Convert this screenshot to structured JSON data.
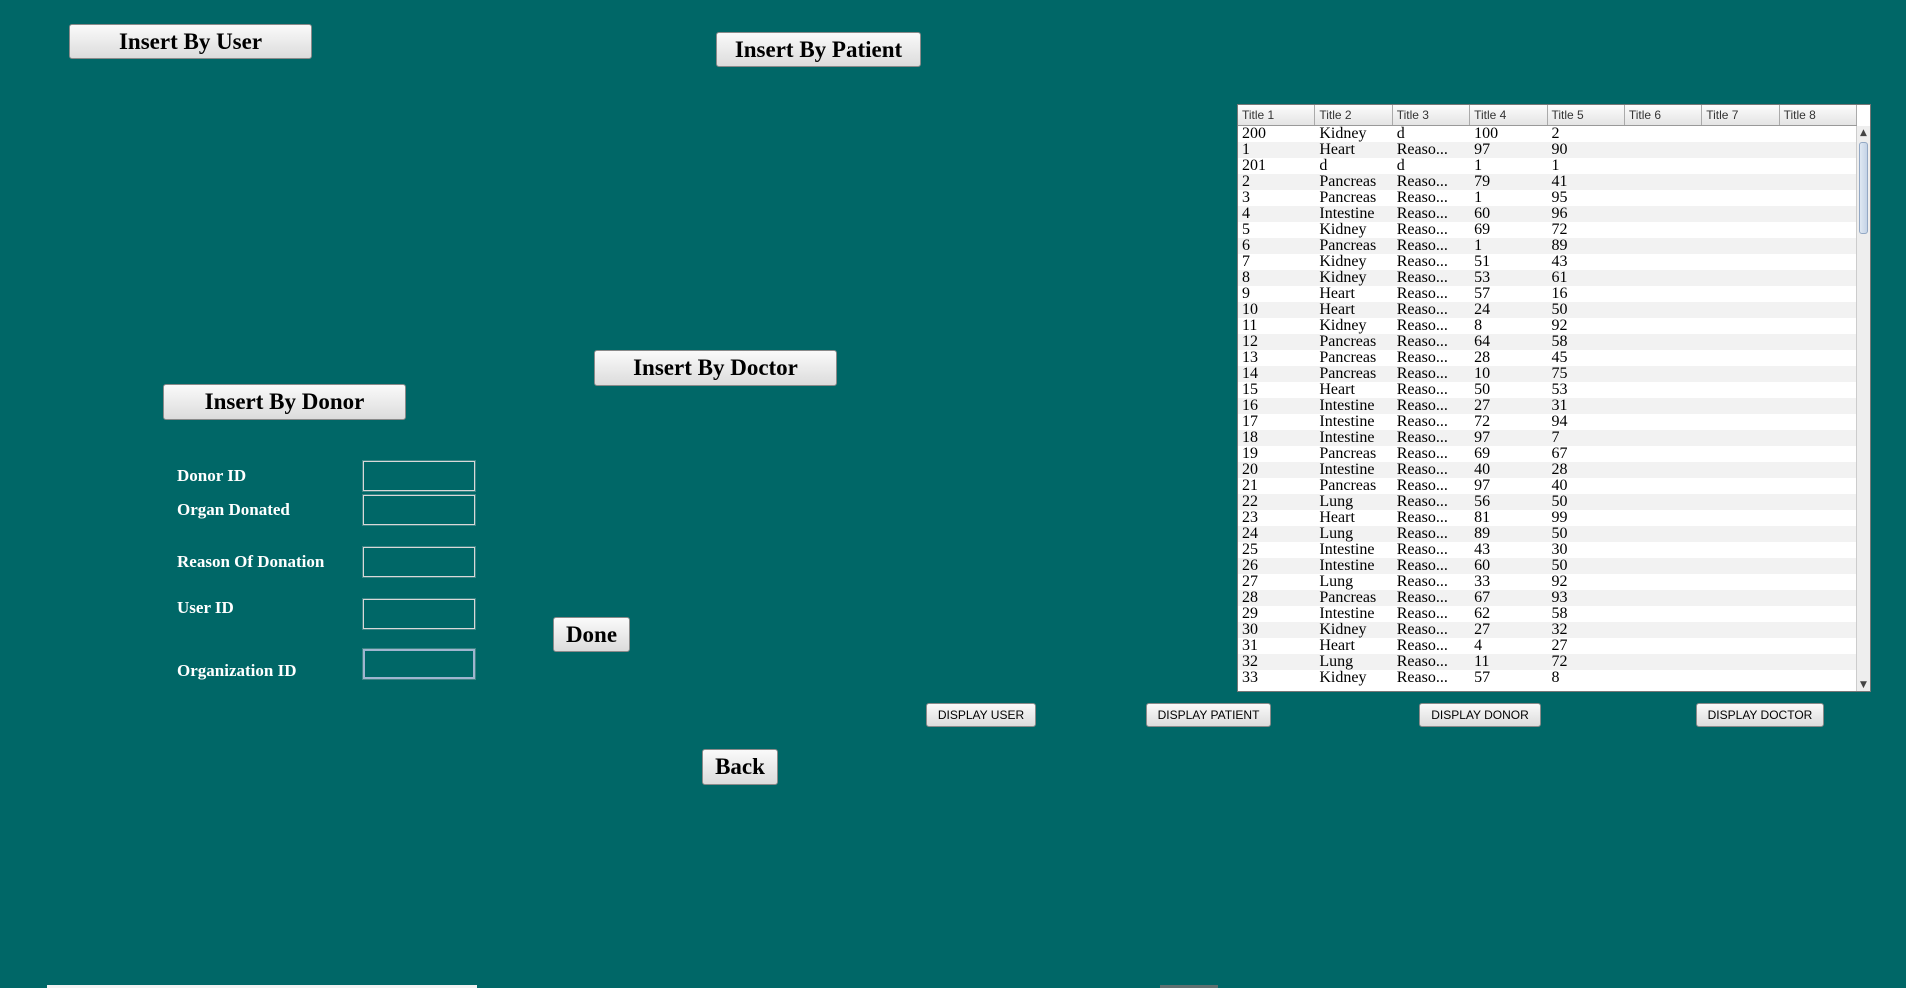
{
  "buttons": {
    "insert_user": "Insert By User",
    "insert_patient": "Insert By Patient",
    "insert_doctor": "Insert By Doctor",
    "insert_donor": "Insert By Donor",
    "done": "Done",
    "back": "Back",
    "display_user": "DISPLAY USER",
    "display_patient": "DISPLAY PATIENT",
    "display_donor": "DISPLAY DONOR",
    "display_doctor": "DISPLAY DOCTOR"
  },
  "form": {
    "donor_id_label": "Donor ID",
    "organ_label": "Organ Donated",
    "reason_label": "Reason Of Donation",
    "user_id_label": "User ID",
    "org_id_label": "Organization ID",
    "donor_id_value": "",
    "organ_value": "",
    "reason_value": "",
    "user_id_value": "",
    "org_id_value": ""
  },
  "table": {
    "columns": [
      "Title 1",
      "Title 2",
      "Title 3",
      "Title 4",
      "Title 5",
      "Title 6",
      "Title 7",
      "Title 8"
    ],
    "rows": [
      [
        "200",
        "Kidney",
        "d",
        "100",
        "2",
        "",
        "",
        ""
      ],
      [
        "1",
        "Heart",
        "Reaso...",
        "97",
        "90",
        "",
        "",
        ""
      ],
      [
        "201",
        "d",
        "d",
        "1",
        "1",
        "",
        "",
        ""
      ],
      [
        "2",
        "Pancreas",
        "Reaso...",
        "79",
        "41",
        "",
        "",
        ""
      ],
      [
        "3",
        "Pancreas",
        "Reaso...",
        "1",
        "95",
        "",
        "",
        ""
      ],
      [
        "4",
        "Intestine",
        "Reaso...",
        "60",
        "96",
        "",
        "",
        ""
      ],
      [
        "5",
        "Kidney",
        "Reaso...",
        "69",
        "72",
        "",
        "",
        ""
      ],
      [
        "6",
        "Pancreas",
        "Reaso...",
        "1",
        "89",
        "",
        "",
        ""
      ],
      [
        "7",
        "Kidney",
        "Reaso...",
        "51",
        "43",
        "",
        "",
        ""
      ],
      [
        "8",
        "Kidney",
        "Reaso...",
        "53",
        "61",
        "",
        "",
        ""
      ],
      [
        "9",
        "Heart",
        "Reaso...",
        "57",
        "16",
        "",
        "",
        ""
      ],
      [
        "10",
        "Heart",
        "Reaso...",
        "24",
        "50",
        "",
        "",
        ""
      ],
      [
        "11",
        "Kidney",
        "Reaso...",
        "8",
        "92",
        "",
        "",
        ""
      ],
      [
        "12",
        "Pancreas",
        "Reaso...",
        "64",
        "58",
        "",
        "",
        ""
      ],
      [
        "13",
        "Pancreas",
        "Reaso...",
        "28",
        "45",
        "",
        "",
        ""
      ],
      [
        "14",
        "Pancreas",
        "Reaso...",
        "10",
        "75",
        "",
        "",
        ""
      ],
      [
        "15",
        "Heart",
        "Reaso...",
        "50",
        "53",
        "",
        "",
        ""
      ],
      [
        "16",
        "Intestine",
        "Reaso...",
        "27",
        "31",
        "",
        "",
        ""
      ],
      [
        "17",
        "Intestine",
        "Reaso...",
        "72",
        "94",
        "",
        "",
        ""
      ],
      [
        "18",
        "Intestine",
        "Reaso...",
        "97",
        "7",
        "",
        "",
        ""
      ],
      [
        "19",
        "Pancreas",
        "Reaso...",
        "69",
        "67",
        "",
        "",
        ""
      ],
      [
        "20",
        "Intestine",
        "Reaso...",
        "40",
        "28",
        "",
        "",
        ""
      ],
      [
        "21",
        "Pancreas",
        "Reaso...",
        "97",
        "40",
        "",
        "",
        ""
      ],
      [
        "22",
        "Lung",
        "Reaso...",
        "56",
        "50",
        "",
        "",
        ""
      ],
      [
        "23",
        "Heart",
        "Reaso...",
        "81",
        "99",
        "",
        "",
        ""
      ],
      [
        "24",
        "Lung",
        "Reaso...",
        "89",
        "50",
        "",
        "",
        ""
      ],
      [
        "25",
        "Intestine",
        "Reaso...",
        "43",
        "30",
        "",
        "",
        ""
      ],
      [
        "26",
        "Intestine",
        "Reaso...",
        "60",
        "50",
        "",
        "",
        ""
      ],
      [
        "27",
        "Lung",
        "Reaso...",
        "33",
        "92",
        "",
        "",
        ""
      ],
      [
        "28",
        "Pancreas",
        "Reaso...",
        "67",
        "93",
        "",
        "",
        ""
      ],
      [
        "29",
        "Intestine",
        "Reaso...",
        "62",
        "58",
        "",
        "",
        ""
      ],
      [
        "30",
        "Kidney",
        "Reaso...",
        "27",
        "32",
        "",
        "",
        ""
      ],
      [
        "31",
        "Heart",
        "Reaso...",
        "4",
        "27",
        "",
        "",
        ""
      ],
      [
        "32",
        "Lung",
        "Reaso...",
        "11",
        "72",
        "",
        "",
        ""
      ],
      [
        "33",
        "Kidney",
        "Reaso...",
        "57",
        "8",
        "",
        "",
        ""
      ]
    ]
  },
  "colors": {
    "background": "#006767",
    "label_text": "#ffffff"
  }
}
